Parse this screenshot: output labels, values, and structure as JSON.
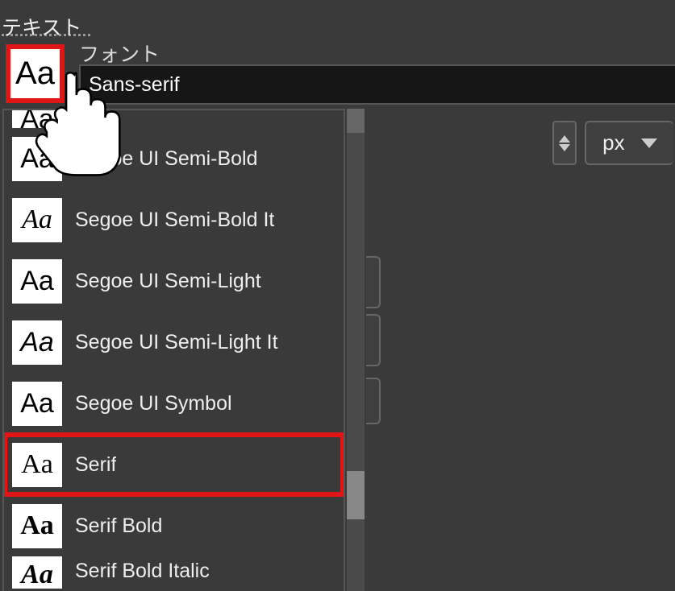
{
  "panel_title": "テキスト",
  "font_label": "フォント",
  "font_value": "Sans-serif",
  "aa_sample": "Aa",
  "unit": "px",
  "fonts": [
    {
      "name": "",
      "style": "sans",
      "cut": "top"
    },
    {
      "name": "Segoe UI Semi-Bold",
      "style": "sans"
    },
    {
      "name": "Segoe UI Semi-Bold It",
      "style": "italic"
    },
    {
      "name": "Segoe UI Semi-Light",
      "style": "light"
    },
    {
      "name": "Segoe UI Semi-Light It",
      "style": "light-italic"
    },
    {
      "name": "Segoe UI Symbol",
      "style": "sans"
    },
    {
      "name": "Serif",
      "style": "serif",
      "highlight": true
    },
    {
      "name": "Serif Bold",
      "style": "serif-bold"
    },
    {
      "name": "Serif Bold Italic",
      "style": "serif-bold-italic",
      "cut": "bot"
    }
  ]
}
